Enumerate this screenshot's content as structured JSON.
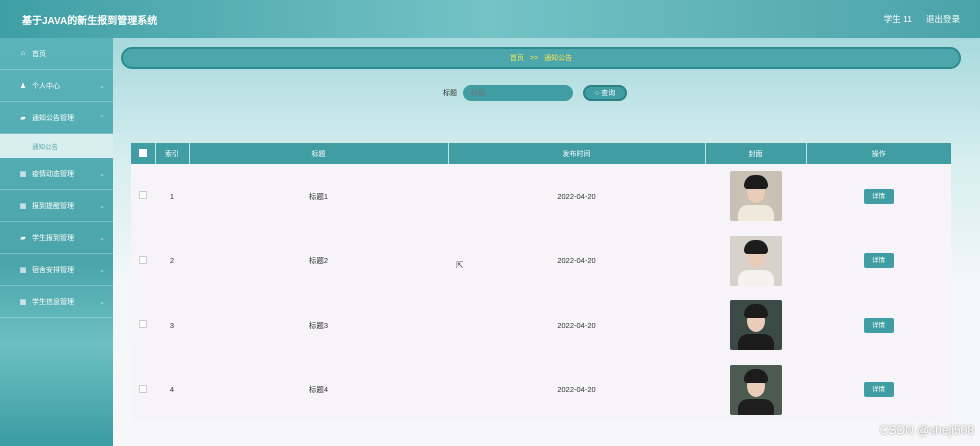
{
  "header": {
    "title": "基于JAVA的新生报到管理系统",
    "user": "学生 11",
    "logout": "退出登录"
  },
  "sidebar": {
    "items": [
      {
        "label": "首页",
        "icon": "home-icon",
        "glyph": "⌂"
      },
      {
        "label": "个人中心",
        "icon": "person-icon",
        "glyph": "♟"
      },
      {
        "label": "通知公告管理",
        "icon": "bank-icon",
        "glyph": "▰"
      },
      {
        "label": "疫情动态管理",
        "icon": "grid-icon",
        "glyph": "▦"
      },
      {
        "label": "报到提醒管理",
        "icon": "grid-icon",
        "glyph": "▦"
      },
      {
        "label": "学生报到管理",
        "icon": "bank-icon",
        "glyph": "▰"
      },
      {
        "label": "宿舍安排管理",
        "icon": "grid-icon",
        "glyph": "▦"
      },
      {
        "label": "学生信息管理",
        "icon": "grid-icon",
        "glyph": "▦"
      }
    ],
    "subitem": "通知公告"
  },
  "breadcrumb": {
    "home": "首页",
    "sep": ">>",
    "current": "通知公告"
  },
  "search": {
    "label": "标题",
    "placeholder": "标题",
    "button": "查询"
  },
  "table": {
    "headers": [
      "索引",
      "标题",
      "发布时间",
      "封面",
      "操作"
    ],
    "rows": [
      {
        "index": "1",
        "title": "标题1",
        "date": "2022-04-20",
        "action": "详情",
        "bg": "#c9c2b4",
        "shirt": "#efe9dc"
      },
      {
        "index": "2",
        "title": "标题2",
        "date": "2022-04-20",
        "action": "详情",
        "bg": "#d7d2cc",
        "shirt": "#f4f2ef"
      },
      {
        "index": "3",
        "title": "标题3",
        "date": "2022-04-20",
        "action": "详情",
        "bg": "#3c4a45",
        "shirt": "#1b1b1b"
      },
      {
        "index": "4",
        "title": "标题4",
        "date": "2022-04-20",
        "action": "详情",
        "bg": "#4c5a52",
        "shirt": "#1f1f1f"
      }
    ]
  },
  "watermark": "CSDN @sheji508"
}
